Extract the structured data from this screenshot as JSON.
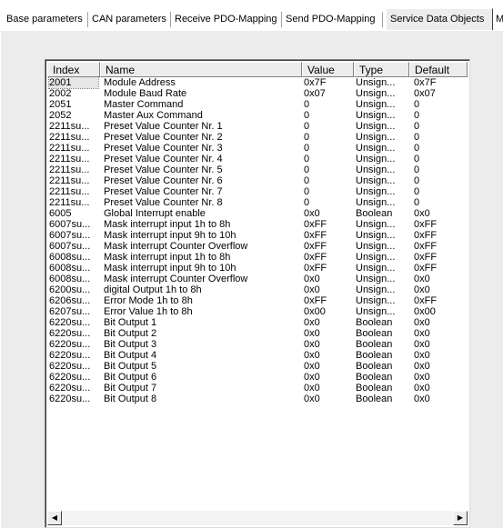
{
  "tabs": [
    {
      "label": "Base parameters"
    },
    {
      "label": "CAN parameters"
    },
    {
      "label": "Receive PDO-Mapping"
    },
    {
      "label": "Send PDO-Mapping"
    },
    {
      "label": "Service Data Objects"
    },
    {
      "label": "M"
    }
  ],
  "active_tab": "Service Data Objects",
  "table": {
    "columns": {
      "index": "Index",
      "name": "Name",
      "value": "Value",
      "type": "Type",
      "default": "Default"
    },
    "rows": [
      {
        "index": "2001",
        "name": "Module Address",
        "value": "0x7F",
        "type": "Unsign...",
        "default": "0x7F"
      },
      {
        "index": "2002",
        "name": "Module Baud Rate",
        "value": "0x07",
        "type": "Unsign...",
        "default": "0x07"
      },
      {
        "index": "2051",
        "name": "Master Command",
        "value": "0",
        "type": "Unsign...",
        "default": "0"
      },
      {
        "index": "2052",
        "name": "Master Aux Command",
        "value": "0",
        "type": "Unsign...",
        "default": "0"
      },
      {
        "index": "2211su...",
        "name": "Preset Value Counter Nr. 1",
        "value": "0",
        "type": "Unsign...",
        "default": "0"
      },
      {
        "index": "2211su...",
        "name": "Preset Value Counter Nr. 2",
        "value": "0",
        "type": "Unsign...",
        "default": "0"
      },
      {
        "index": "2211su...",
        "name": "Preset Value Counter Nr. 3",
        "value": "0",
        "type": "Unsign...",
        "default": "0"
      },
      {
        "index": "2211su...",
        "name": "Preset Value Counter Nr. 4",
        "value": "0",
        "type": "Unsign...",
        "default": "0"
      },
      {
        "index": "2211su...",
        "name": "Preset Value Counter Nr. 5",
        "value": "0",
        "type": "Unsign...",
        "default": "0"
      },
      {
        "index": "2211su...",
        "name": "Preset Value Counter Nr. 6",
        "value": "0",
        "type": "Unsign...",
        "default": "0"
      },
      {
        "index": "2211su...",
        "name": "Preset Value Counter Nr. 7",
        "value": "0",
        "type": "Unsign...",
        "default": "0"
      },
      {
        "index": "2211su...",
        "name": "Preset Value Counter Nr. 8",
        "value": "0",
        "type": "Unsign...",
        "default": "0"
      },
      {
        "index": "6005",
        "name": "Global Interrupt enable",
        "value": "0x0",
        "type": "Boolean",
        "default": "0x0"
      },
      {
        "index": "6007su...",
        "name": "Mask interrupt input 1h to 8h",
        "value": "0xFF",
        "type": "Unsign...",
        "default": "0xFF"
      },
      {
        "index": "6007su...",
        "name": "Mask interrupt input 9h to 10h",
        "value": "0xFF",
        "type": "Unsign...",
        "default": "0xFF"
      },
      {
        "index": "6007su...",
        "name": "Mask interrupt Counter Overflow",
        "value": "0xFF",
        "type": "Unsign...",
        "default": "0xFF"
      },
      {
        "index": "6008su...",
        "name": "Mask interrupt input 1h to 8h",
        "value": "0xFF",
        "type": "Unsign...",
        "default": "0xFF"
      },
      {
        "index": "6008su...",
        "name": "Mask interrupt input 9h to 10h",
        "value": "0xFF",
        "type": "Unsign...",
        "default": "0xFF"
      },
      {
        "index": "6008su...",
        "name": "Mask interrupt Counter Overflow",
        "value": "0x0",
        "type": "Unsign...",
        "default": "0x0"
      },
      {
        "index": "6200su...",
        "name": "digital Output 1h to 8h",
        "value": "0x0",
        "type": "Unsign...",
        "default": "0x0"
      },
      {
        "index": "6206su...",
        "name": "Error Mode 1h to 8h",
        "value": "0xFF",
        "type": "Unsign...",
        "default": "0xFF"
      },
      {
        "index": "6207su...",
        "name": "Error Value 1h to 8h",
        "value": "0x00",
        "type": "Unsign...",
        "default": "0x00"
      },
      {
        "index": "6220su...",
        "name": "Bit Output 1",
        "value": "0x0",
        "type": "Boolean",
        "default": "0x0"
      },
      {
        "index": "6220su...",
        "name": "Bit Output 2",
        "value": "0x0",
        "type": "Boolean",
        "default": "0x0"
      },
      {
        "index": "6220su...",
        "name": "Bit Output 3",
        "value": "0x0",
        "type": "Boolean",
        "default": "0x0"
      },
      {
        "index": "6220su...",
        "name": "Bit Output 4",
        "value": "0x0",
        "type": "Boolean",
        "default": "0x0"
      },
      {
        "index": "6220su...",
        "name": "Bit Output 5",
        "value": "0x0",
        "type": "Boolean",
        "default": "0x0"
      },
      {
        "index": "6220su...",
        "name": "Bit Output 6",
        "value": "0x0",
        "type": "Boolean",
        "default": "0x0"
      },
      {
        "index": "6220su...",
        "name": "Bit Output 7",
        "value": "0x0",
        "type": "Boolean",
        "default": "0x0"
      },
      {
        "index": "6220su...",
        "name": "Bit Output 8",
        "value": "0x0",
        "type": "Boolean",
        "default": "0x0"
      }
    ]
  },
  "scrollbar": {
    "left_icon": "arrow-left-icon",
    "right_icon": "arrow-right-icon"
  }
}
